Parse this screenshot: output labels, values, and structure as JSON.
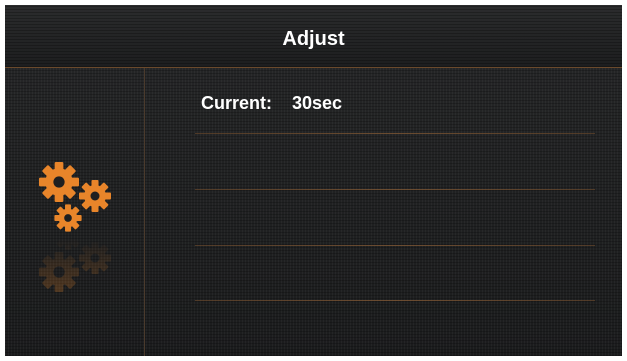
{
  "header": {
    "title": "Adjust"
  },
  "sidebar": {
    "icon": "gears-icon"
  },
  "main": {
    "current_label": "Current:",
    "current_value": "30sec",
    "option_rows": [
      "",
      "",
      "",
      ""
    ]
  },
  "colors": {
    "accent": "#e8852a",
    "background": "#1e1f20",
    "divider": "#6b4a2c",
    "text": "#ffffff"
  }
}
